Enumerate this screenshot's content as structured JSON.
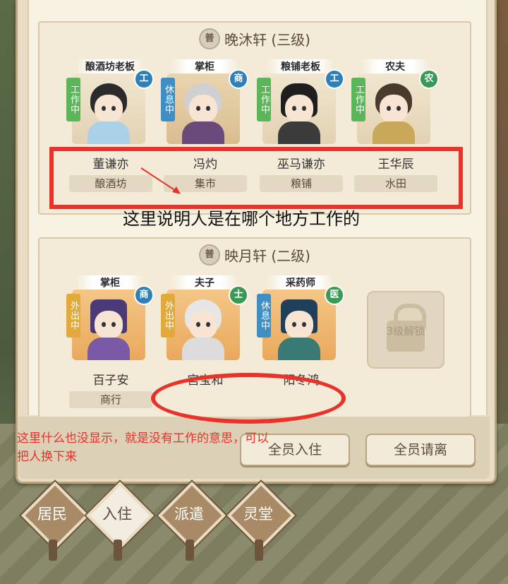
{
  "houses": [
    {
      "grade_badge": "普",
      "title": "晚沐轩 (三级)",
      "residents": [
        {
          "role": "酿酒坊老板",
          "status": "工作中",
          "badge": "工",
          "name": "董谦亦",
          "place": "酿酒坊"
        },
        {
          "role": "掌柜",
          "status": "休息中",
          "badge": "商",
          "name": "冯灼",
          "place": "集市"
        },
        {
          "role": "粮铺老板",
          "status": "工作中",
          "badge": "工",
          "name": "巫马谦亦",
          "place": "粮铺"
        },
        {
          "role": "农夫",
          "status": "工作中",
          "badge": "农",
          "name": "王华辰",
          "place": "水田"
        }
      ]
    },
    {
      "grade_badge": "普",
      "title": "映月轩 (二级)",
      "residents": [
        {
          "role": "掌柜",
          "status": "外出中",
          "badge": "商",
          "name": "百子安",
          "place": "商行"
        },
        {
          "role": "夫子",
          "status": "外出中",
          "badge": "士",
          "name": "宫宝和",
          "place": ""
        },
        {
          "role": "采药师",
          "status": "休息中",
          "badge": "医",
          "name": "阳冬鸿",
          "place": ""
        }
      ],
      "locked_slot": "3级解锁"
    }
  ],
  "annotations": {
    "box_note": "这里说明人是在哪个地方工作的",
    "ellipse_note": "这里什么也没显示，就是没有工作的意思，可以把人换下来"
  },
  "buttons": {
    "all_move_in": "全员入住",
    "all_move_out": "全员请离"
  },
  "tabs": [
    "居民",
    "入住",
    "派遣",
    "灵堂"
  ],
  "active_tab": "入住",
  "colors": {
    "annotation_red": "#e8322a",
    "status_working": "#5bb65a",
    "status_away": "#e2a93b",
    "status_resting": "#3f8fc4"
  }
}
